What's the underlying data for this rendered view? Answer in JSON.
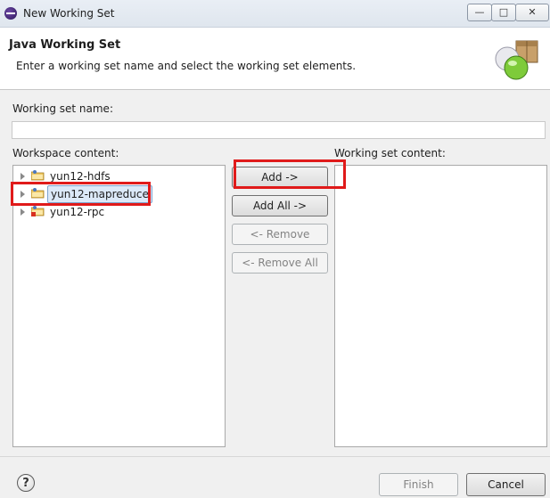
{
  "window": {
    "title": "New Working Set",
    "controls": {
      "minimize": "—",
      "maximize": "□",
      "close": "✕"
    }
  },
  "header": {
    "title": "Java Working Set",
    "description": "Enter a working set name and select the working set elements.",
    "icon": "working-set-wizard-icon"
  },
  "name_field": {
    "label": "Working set name:",
    "value": "",
    "placeholder": ""
  },
  "workspace": {
    "label": "Workspace content:",
    "items": [
      {
        "label": "yun12-hdfs",
        "icon": "java-project-folder-icon",
        "selected": false
      },
      {
        "label": "yun12-mapreduce",
        "icon": "java-project-folder-icon",
        "selected": true
      },
      {
        "label": "yun12-rpc",
        "icon": "java-project-folder-error-icon",
        "selected": false
      }
    ]
  },
  "working_set": {
    "label": "Working set content:",
    "items": []
  },
  "buttons": {
    "add": "Add ->",
    "add_all": "Add All ->",
    "remove": "<- Remove",
    "remove_all": "<- Remove All"
  },
  "footer": {
    "help": "?",
    "finish": "Finish",
    "cancel": "Cancel"
  },
  "colors": {
    "highlight": "#e01a1a",
    "selection": "#dce9f8"
  }
}
